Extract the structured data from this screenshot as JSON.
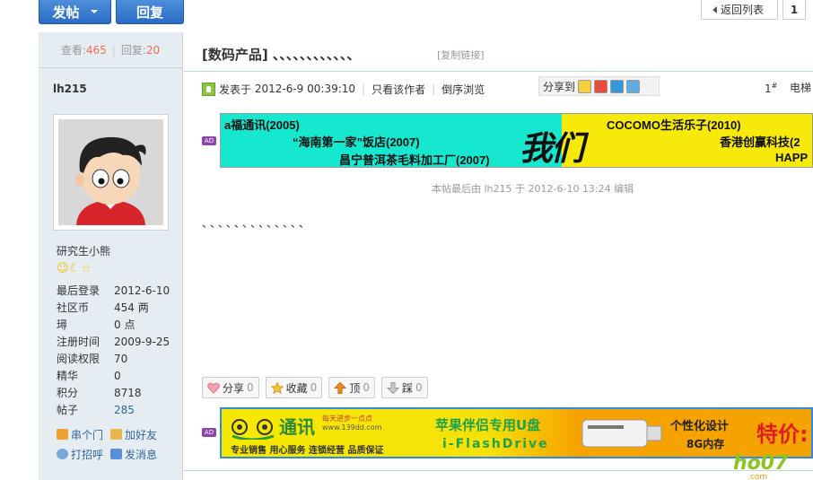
{
  "toolbar": {
    "post_label": "发帖",
    "reply_label": "回复",
    "back_list_label": "返回列表",
    "page_current": "1"
  },
  "thread_stats": {
    "views_label": "查看:",
    "views": "465",
    "replies_label": "回复:",
    "replies": "20"
  },
  "author": {
    "name": "lh215",
    "rank": "研究生小熊",
    "fields": [
      {
        "k": "最后登录",
        "v": "2012-6-10"
      },
      {
        "k": "社区币",
        "v": "454 两"
      },
      {
        "k": "璕",
        "v": "0 点"
      },
      {
        "k": "注册时间",
        "v": "2009-9-25"
      },
      {
        "k": "阅读权限",
        "v": "70"
      },
      {
        "k": "精华",
        "v": "0"
      },
      {
        "k": "积分",
        "v": "8718"
      },
      {
        "k": "帖子",
        "v": "285"
      }
    ],
    "actions": {
      "chuanmen": "串个门",
      "add_friend": "加好友",
      "greet": "打招呼",
      "message": "发消息"
    }
  },
  "post": {
    "title": "[数码产品] 、、、、、、、、、、、、",
    "copy_link": "[复制链接]",
    "posted_label": "发表于",
    "posted_time": "2012-6-9 00:39:10",
    "only_author": "只看该作者",
    "reverse": "倒序浏览",
    "share_to": "分享到",
    "floor": "1",
    "floor_sup": "#",
    "floor2": "电梯",
    "edited_note": "本帖最后由 lh215 于 2012-6-10 13:24 编辑",
    "content": "、、、、、、、、、、、、、",
    "buttons": [
      {
        "label": "分享",
        "count": "0"
      },
      {
        "label": "收藏",
        "count": "0"
      },
      {
        "label": "顶",
        "count": "0"
      },
      {
        "label": "踩",
        "count": "0"
      }
    ]
  },
  "ad_tag": "AD",
  "banner1": {
    "line1": "a福通讯(2005)",
    "line2": "“海南第一家”饭店(2007)",
    "line3": "昌宁普洱茶毛料加工厂(2007)",
    "center": "我们",
    "r1": "COCOMO生活乐子(2010)",
    "r2": "香港创赢科技(2",
    "r3": "HAPP"
  },
  "banner2": {
    "brand": "通讯",
    "slogan": "每天进步一点点",
    "site": "www.139dd.com",
    "tags": "专业销售  用心服务  连锁经营  品质保证",
    "product": "苹果伴侣专用U盘",
    "product_en": "i-FlashDrive",
    "custom": "个性化设计",
    "memory": "8G内存",
    "price": "特价:"
  },
  "watermark": "ho07",
  "watermark_site": ".com"
}
